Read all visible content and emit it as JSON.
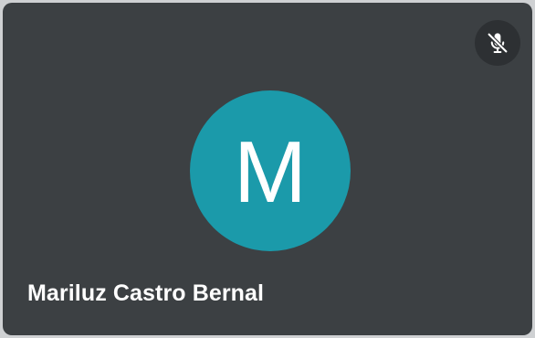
{
  "participant": {
    "name": "Mariluz Castro Bernal",
    "initial": "M",
    "avatar_color": "#1b9aaa",
    "mic_status": "muted",
    "mic_icon": "mic-off-icon"
  },
  "colors": {
    "tile_background": "#3c4043",
    "badge_background": "#2d3033",
    "text": "#ffffff"
  }
}
